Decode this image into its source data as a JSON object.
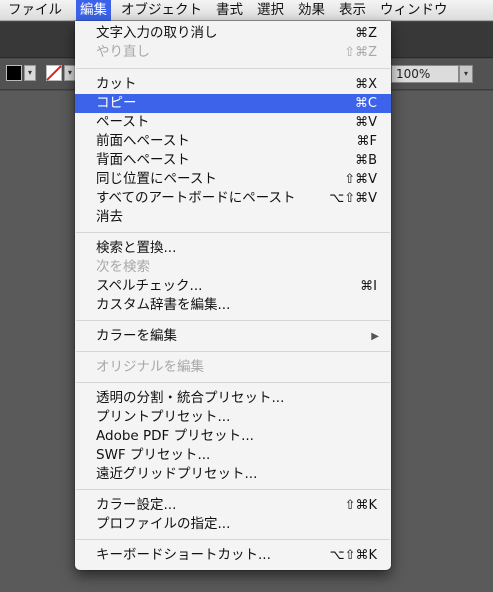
{
  "menubar": {
    "items": [
      "ファイル",
      "編集",
      "オブジェクト",
      "書式",
      "選択",
      "効果",
      "表示",
      "ウィンドウ"
    ]
  },
  "controls": {
    "zoom": "100%"
  },
  "menu": {
    "items": [
      {
        "label": "文字入力の取り消し",
        "shortcut": "⌘Z",
        "disabled": false
      },
      {
        "label": "やり直し",
        "shortcut": "⇧⌘Z",
        "disabled": true
      },
      {
        "label": "カット",
        "shortcut": "⌘X",
        "disabled": false
      },
      {
        "label": "コピー",
        "shortcut": "⌘C",
        "disabled": false,
        "highlighted": true
      },
      {
        "label": "ペースト",
        "shortcut": "⌘V",
        "disabled": false
      },
      {
        "label": "前面へペースト",
        "shortcut": "⌘F",
        "disabled": false
      },
      {
        "label": "背面へペースト",
        "shortcut": "⌘B",
        "disabled": false
      },
      {
        "label": "同じ位置にペースト",
        "shortcut": "⇧⌘V",
        "disabled": false
      },
      {
        "label": "すべてのアートボードにペースト",
        "shortcut": "⌥⇧⌘V",
        "disabled": false
      },
      {
        "label": "消去",
        "shortcut": "",
        "disabled": false
      },
      {
        "label": "検索と置換...",
        "shortcut": "",
        "disabled": false
      },
      {
        "label": "次を検索",
        "shortcut": "",
        "disabled": true
      },
      {
        "label": "スペルチェック...",
        "shortcut": "⌘I",
        "disabled": false
      },
      {
        "label": "カスタム辞書を編集...",
        "shortcut": "",
        "disabled": false
      },
      {
        "label": "カラーを編集",
        "shortcut": "",
        "disabled": false,
        "submenu": true
      },
      {
        "label": "オリジナルを編集",
        "shortcut": "",
        "disabled": true
      },
      {
        "label": "透明の分割・統合プリセット...",
        "shortcut": "",
        "disabled": false
      },
      {
        "label": "プリントプリセット...",
        "shortcut": "",
        "disabled": false
      },
      {
        "label": "Adobe PDF プリセット...",
        "shortcut": "",
        "disabled": false
      },
      {
        "label": "SWF プリセット...",
        "shortcut": "",
        "disabled": false
      },
      {
        "label": "遠近グリッドプリセット...",
        "shortcut": "",
        "disabled": false
      },
      {
        "label": "カラー設定...",
        "shortcut": "⇧⌘K",
        "disabled": false
      },
      {
        "label": "プロファイルの指定...",
        "shortcut": "",
        "disabled": false
      },
      {
        "label": "キーボードショートカット...",
        "shortcut": "⌥⇧⌘K",
        "disabled": false
      }
    ]
  }
}
